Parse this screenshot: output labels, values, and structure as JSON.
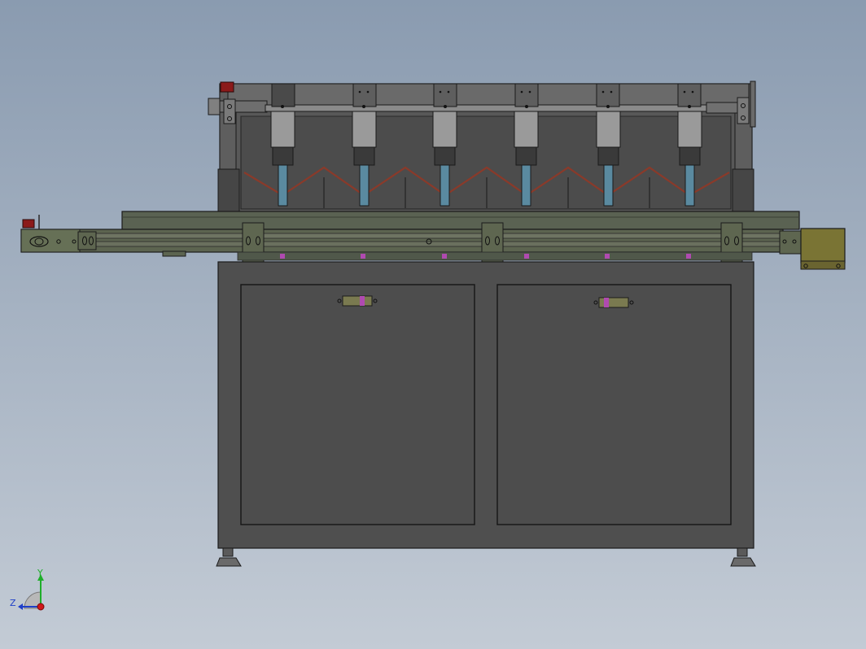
{
  "viewport": {
    "colors": {
      "background_top": "#8a9bb0",
      "background_bottom": "#c3cbd5",
      "cabinet": "#4f4f4f",
      "frame": "#5a5a5a",
      "edge": "#1a1a1a",
      "conveyor": "#5c6450",
      "motor": "#7a7434",
      "cylinder_body": "#9a9a9a",
      "cylinder_rod": "#5a8aa0",
      "zigzag": "#8a3a2a",
      "accent_magenta": "#b04ab0",
      "accent_red": "#8b1a1a"
    }
  },
  "assembly": {
    "cylinder_count": 6,
    "door_count": 2,
    "door_latch_icon": "latch-icon",
    "foot_icon": "leveling-foot-icon"
  },
  "triad": {
    "y_label": "Y",
    "z_label": "Z",
    "y_color": "#1fae2a",
    "z_color": "#1f3fc8",
    "x_color": "#d01818"
  }
}
